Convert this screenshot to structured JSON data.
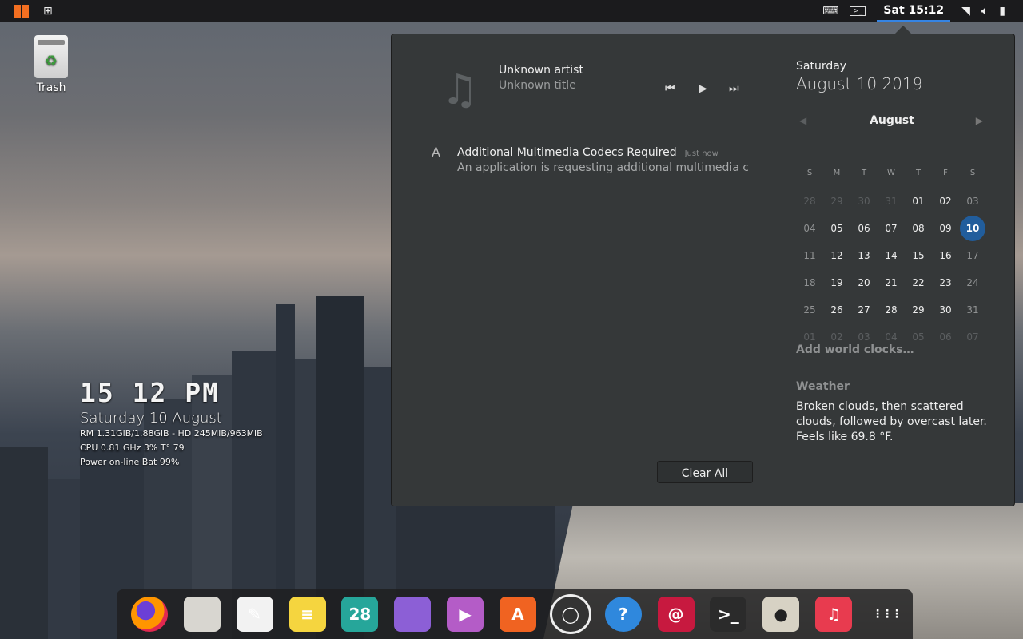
{
  "topbar": {
    "activities_icon": "activities-icon",
    "apps_icon": "app-grid-icon",
    "clock": "Sat 15:12",
    "tray_icons": [
      "keyboard-icon",
      "terminal-indicator-icon",
      "wifi-icon",
      "volume-icon",
      "battery-icon"
    ]
  },
  "desktop": {
    "trash_label": "Trash"
  },
  "conky": {
    "time": "15 12 PM",
    "date": "Saturday 10 August",
    "line1": "RM 1.31GiB/1.88GiB - HD 245MiB/963MiB",
    "line2": "CPU 0.81 GHz 3% T° 79",
    "line3": "Power on-line Bat 99%"
  },
  "media": {
    "artist": "Unknown artist",
    "title": "Unknown title"
  },
  "notification": {
    "title": "Additional Multimedia Codecs Required",
    "time": "Just now",
    "body": "An application is requesting additional multimedia cod…"
  },
  "clear_all": "Clear All",
  "calendar": {
    "weekday": "Saturday",
    "full_date": "August 10 2019",
    "month": "August",
    "day_headers": [
      "S",
      "M",
      "T",
      "W",
      "T",
      "F",
      "S"
    ],
    "weeks": [
      [
        "28",
        "29",
        "30",
        "31",
        "01",
        "02",
        "03"
      ],
      [
        "04",
        "05",
        "06",
        "07",
        "08",
        "09",
        "10"
      ],
      [
        "11",
        "12",
        "13",
        "14",
        "15",
        "16",
        "17"
      ],
      [
        "18",
        "19",
        "20",
        "21",
        "22",
        "23",
        "24"
      ],
      [
        "25",
        "26",
        "27",
        "28",
        "29",
        "30",
        "31"
      ],
      [
        "01",
        "02",
        "03",
        "04",
        "05",
        "06",
        "07"
      ]
    ],
    "selected_day": "10",
    "add_world_clocks": "Add world clocks…"
  },
  "weather": {
    "heading": "Weather",
    "text": "Broken clouds, then scattered clouds, followed by overcast later. Feels like 69.8 °F."
  },
  "dock": {
    "apps": [
      {
        "name": "firefox-icon",
        "glyph": "",
        "color": "#e66000"
      },
      {
        "name": "files-icon",
        "glyph": "",
        "color": "#d8d6d0"
      },
      {
        "name": "text-editor-icon",
        "glyph": "✎",
        "color": "#f2f2f2"
      },
      {
        "name": "notes-icon",
        "glyph": "≡",
        "color": "#f5d53f"
      },
      {
        "name": "calendar-icon",
        "glyph": "28",
        "color": "#26a69a"
      },
      {
        "name": "workspace-icon",
        "glyph": "",
        "color": "#8c5fd6"
      },
      {
        "name": "video-player-icon",
        "glyph": "▶",
        "color": "#b45cc7"
      },
      {
        "name": "software-icon",
        "glyph": "A",
        "color": "#f06321"
      },
      {
        "name": "screenshot-icon",
        "glyph": "◯",
        "color": "#444"
      },
      {
        "name": "help-icon",
        "glyph": "?",
        "color": "#2f88dd"
      },
      {
        "name": "debian-installer-icon",
        "glyph": "@",
        "color": "#c7193f"
      },
      {
        "name": "terminal-icon",
        "glyph": ">_",
        "color": "#2b2b2b"
      },
      {
        "name": "rhythmbox-icon",
        "glyph": "●",
        "color": "#d7d2c4"
      },
      {
        "name": "music-icon",
        "glyph": "♫",
        "color": "#e83b4f"
      },
      {
        "name": "show-apps-icon",
        "glyph": "⋮⋮⋮",
        "color": "transparent"
      }
    ]
  }
}
